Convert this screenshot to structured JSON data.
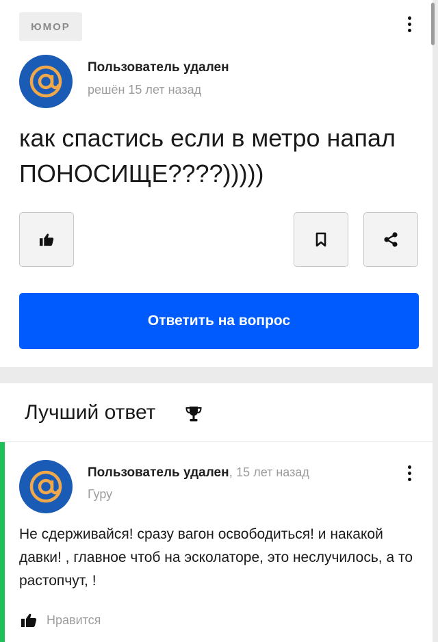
{
  "question_card": {
    "category": "ЮМОР",
    "author": "Пользователь удален",
    "status": "решён 15 лет назад",
    "question": "как спастись если в метро напал ПОНОСИЩЕ????)))))",
    "answer_button": "Ответить на вопрос"
  },
  "best_answer": {
    "heading": "Лучший ответ",
    "author": "Пользователь удален",
    "separator": ",",
    "time": "15 лет назад",
    "rank": "Гуру",
    "text": "Не сдерживайся! сразу вагон освободиться! и накакой давки! , главное чтоб на эсколаторе, это неслучилось, а то растопчут, !",
    "like_label": "Нравится"
  },
  "icons": [
    "kebab-menu-icon",
    "avatar-at-icon",
    "thumbs-up-icon",
    "bookmark-icon",
    "share-icon",
    "trophy-icon"
  ],
  "colors": {
    "accent": "#005bff",
    "best_answer_stripe": "#1fc05a",
    "avatar_bg": "#1a5bb5",
    "avatar_symbol": "#f0a84a"
  }
}
